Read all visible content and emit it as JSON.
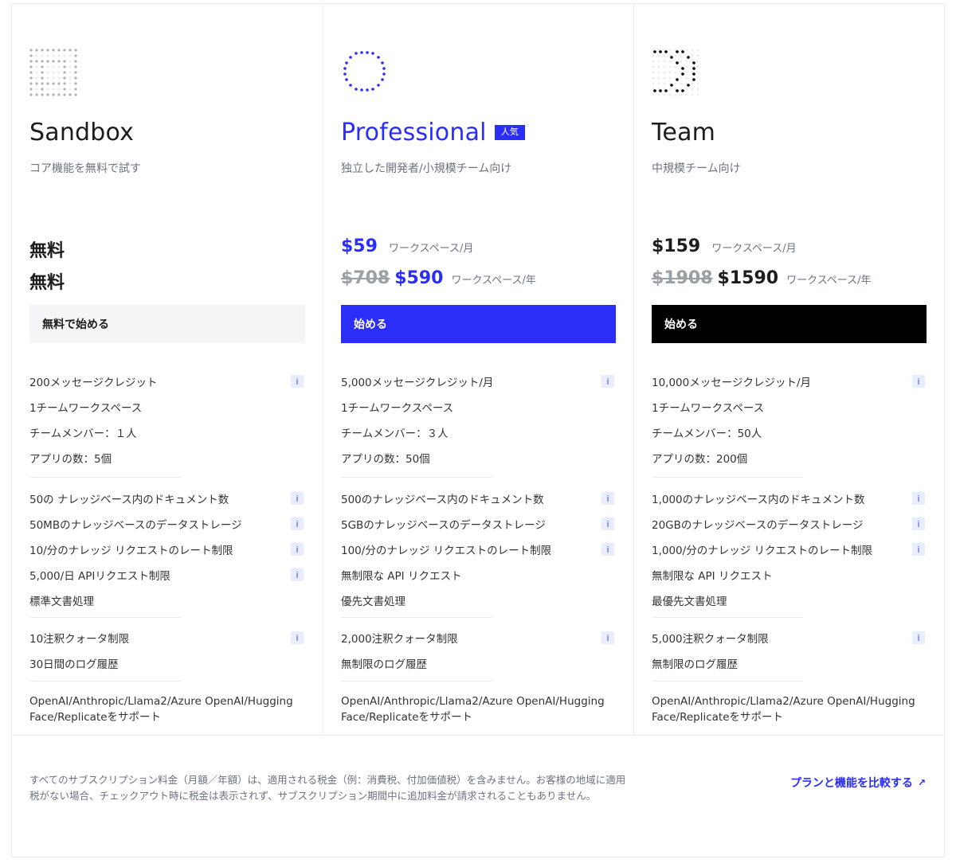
{
  "colors": {
    "accent": "#2a2ef8",
    "black": "#000000",
    "muted_bg": "#f4f5f7"
  },
  "plans": [
    {
      "name": "Sandbox",
      "description": "コア機能を無料で試す",
      "price_line1": "無料",
      "price_line2": "無料",
      "cta_label": "無料で始める",
      "features": [
        {
          "text": "200メッセージクレジット",
          "info": "i"
        },
        {
          "text": "1チームワークスペース"
        },
        {
          "text": "チームメンバー：１人"
        },
        {
          "text": "アプリの数：5個"
        },
        {
          "text": "50の ナレッジベース内のドキュメント数",
          "info": "i"
        },
        {
          "text": "50MBのナレッジベースのデータストレージ",
          "info": "i"
        },
        {
          "text": "10/分のナレッジ リクエストのレート制限",
          "info": "i"
        },
        {
          "text": "5,000/日 APIリクエスト制限",
          "info": "i"
        },
        {
          "text": "標準文書処理"
        },
        {
          "text": "10注釈クォータ制限",
          "info": "i"
        },
        {
          "text": "30日間のログ履歴"
        }
      ],
      "support": "OpenAI/Anthropic/Llama2/Azure OpenAI/Hugging Face/Replicateをサポート"
    },
    {
      "name": "Professional",
      "badge": "人気",
      "description": "独立した開発者/小規模チーム向け",
      "price_monthly": "$59",
      "unit_monthly": "ワークスペース/月",
      "price_yearly_original": "$708",
      "price_yearly": "$590",
      "unit_yearly": "ワークスペース/年",
      "cta_label": "始める",
      "features": [
        {
          "text": "5,000メッセージクレジット/月",
          "info": "i"
        },
        {
          "text": "1チームワークスペース"
        },
        {
          "text": "チームメンバー：３人"
        },
        {
          "text": "アプリの数：50個"
        },
        {
          "text": "500のナレッジベース内のドキュメント数",
          "info": "i"
        },
        {
          "text": "5GBのナレッジベースのデータストレージ",
          "info": "i"
        },
        {
          "text": "100/分のナレッジ リクエストのレート制限",
          "info": "i"
        },
        {
          "text": "無制限な API リクエスト"
        },
        {
          "text": "優先文書処理"
        },
        {
          "text": "2,000注釈クォータ制限",
          "info": "i"
        },
        {
          "text": "無制限のログ履歴"
        }
      ],
      "support": "OpenAI/Anthropic/Llama2/Azure OpenAI/Hugging Face/Replicateをサポート"
    },
    {
      "name": "Team",
      "description": "中規模チーム向け",
      "price_monthly": "$159",
      "unit_monthly": "ワークスペース/月",
      "price_yearly_original": "$1908",
      "price_yearly": "$1590",
      "unit_yearly": "ワークスペース/年",
      "cta_label": "始める",
      "features": [
        {
          "text": "10,000メッセージクレジット/月",
          "info": "i"
        },
        {
          "text": "1チームワークスペース"
        },
        {
          "text": "チームメンバー：50人"
        },
        {
          "text": "アプリの数：200個"
        },
        {
          "text": "1,000のナレッジベース内のドキュメント数",
          "info": "i"
        },
        {
          "text": "20GBのナレッジベースのデータストレージ",
          "info": "i"
        },
        {
          "text": "1,000/分のナレッジ リクエストのレート制限",
          "info": "i"
        },
        {
          "text": "無制限な API リクエスト"
        },
        {
          "text": "最優先文書処理"
        },
        {
          "text": "5,000注釈クォータ制限",
          "info": "i"
        },
        {
          "text": "無制限のログ履歴"
        }
      ],
      "support": "OpenAI/Anthropic/Llama2/Azure OpenAI/Hugging Face/Replicateをサポート"
    }
  ],
  "footnote": "すべてのサブスクリプション料金（月額／年額）は、適用される税金（例：消費税、付加価値税）を含みません。お客様の地域に適用税がない場合、チェックアウト時に税金は表示されず、サブスクリプション期間中に追加料金が請求されることもありません。",
  "compare_link": "プランと機能を比較する",
  "compare_icon": "↗"
}
